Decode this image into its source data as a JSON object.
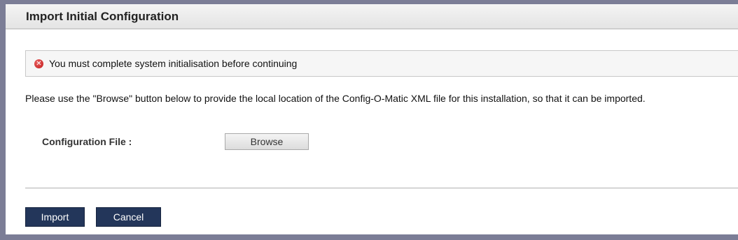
{
  "panel": {
    "title": "Import Initial Configuration"
  },
  "error": {
    "icon": "error-icon",
    "message": "You must complete system initialisation before continuing",
    "icon_color": "#c21a1a"
  },
  "instructions": "Please use the \"Browse\" button below to provide the local location of the Config-O-Matic XML file for this installation, so that it can be imported.",
  "form": {
    "config_file_label": "Configuration File :",
    "browse_label": "Browse"
  },
  "actions": {
    "import_label": "Import",
    "cancel_label": "Cancel",
    "button_color": "#23365a"
  }
}
